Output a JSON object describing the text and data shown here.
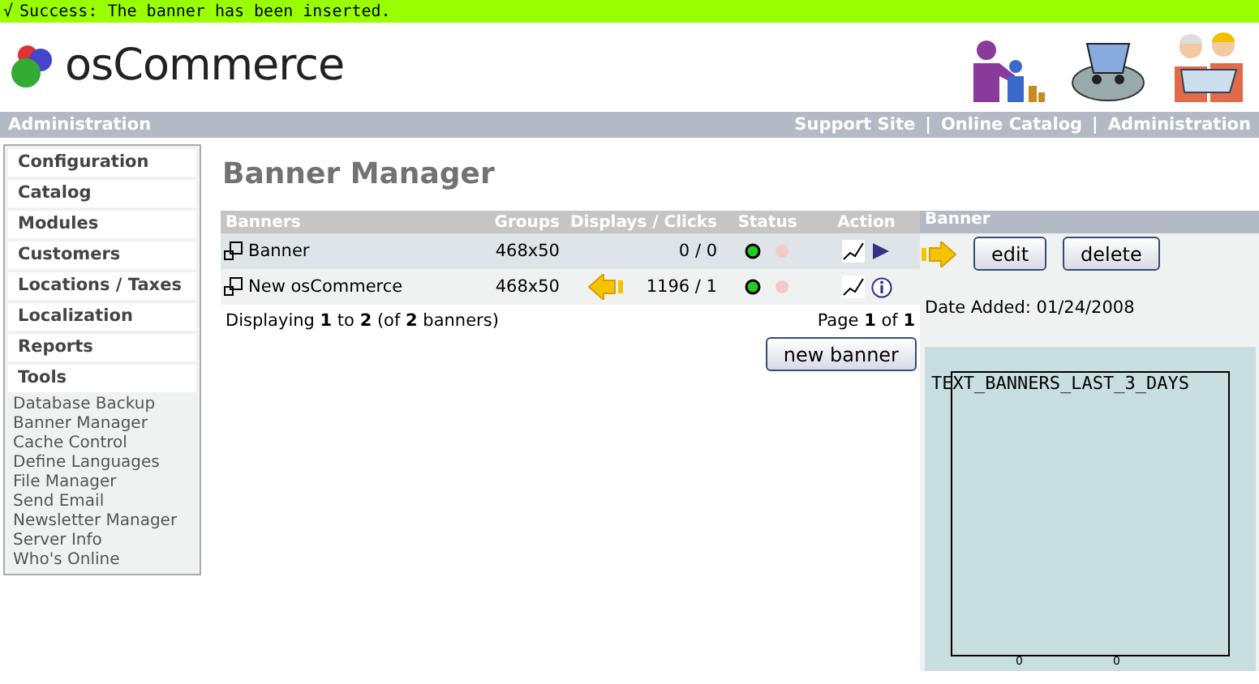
{
  "message": {
    "icon": "√",
    "text": "Success: The banner has been inserted."
  },
  "logo": {
    "text": "osCommerce"
  },
  "header_bar": {
    "title": "Administration",
    "links": [
      "Support Site",
      "Online Catalog",
      "Administration"
    ],
    "separators": [
      "|",
      "|"
    ]
  },
  "sidebar": {
    "groups": [
      {
        "label": "Configuration",
        "expanded": false
      },
      {
        "label": "Catalog",
        "expanded": false
      },
      {
        "label": "Modules",
        "expanded": false
      },
      {
        "label": "Customers",
        "expanded": false
      },
      {
        "label": "Locations / Taxes",
        "expanded": false
      },
      {
        "label": "Localization",
        "expanded": false
      },
      {
        "label": "Reports",
        "expanded": false
      },
      {
        "label": "Tools",
        "expanded": true,
        "children": [
          "Database Backup",
          "Banner Manager",
          "Cache Control",
          "Define Languages",
          "File Manager",
          "Send Email",
          "Newsletter Manager",
          "Server Info",
          "Who's Online"
        ]
      }
    ]
  },
  "page_title": "Banner Manager",
  "table": {
    "columns": [
      "Banners",
      "Groups",
      "Displays / Clicks",
      "Status",
      "Action"
    ],
    "rows": [
      {
        "name": "Banner",
        "group": "468x50",
        "stats": "0 / 0",
        "active": true,
        "selected": true,
        "pointer": false
      },
      {
        "name": "New osCommerce",
        "group": "468x50",
        "stats": "1196 / 1",
        "active": true,
        "selected": false,
        "pointer": true
      }
    ],
    "summary": "Displaying **1** to **2** (of **2** banners)",
    "page": "Page **1** of **1**",
    "button": "new banner"
  },
  "info_panel": {
    "title": "Banner",
    "pointer": true,
    "buttons": [
      "edit",
      "delete"
    ],
    "date": "Date Added: 01/24/2008",
    "chart": {
      "title": "TEXT_BANNERS_LAST_3_DAYS",
      "labels": [
        "0",
        "0"
      ]
    }
  }
}
